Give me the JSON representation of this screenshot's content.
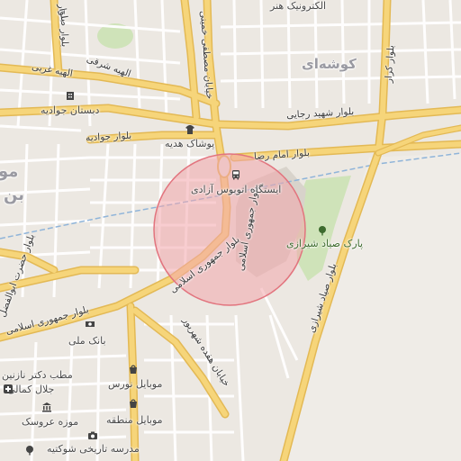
{
  "map": {
    "areas": {
      "goushei": "کوشه‌ای",
      "left_big_1": "مو",
      "left_big_2": "بن"
    },
    "roads": {
      "shahid_rajaee": "بلوار شهید رجایی",
      "emam_reza": "بلوار امام رضا",
      "javadieh": "بلوار جوادیه",
      "elahiye_sharghi": "الهیه شرقی",
      "elahiye_gharbi": "الهیه غربی",
      "solh": "بلوار صلح",
      "mostafa_khomeini": "خیابان مصطفی خمینی",
      "jomhouri_islami_1": "بلوار جمهوری اسلامی",
      "jomhouri_islami_2": "بلوار جمهوری اسلامی",
      "jomhouri_islami_3": "بلوار جمهوری اسلامی",
      "hazrat_abolfazl": "بلوار حضرت ابوالفضل",
      "hefdah_shahrivar": "خیابان هفده شهریور",
      "sayyad_shirazi": "بلوار صیاد شیرازی",
      "karar": "بلوار کرار",
      "bolvar_top_left": "بلوار"
    },
    "pois": {
      "electronic_honar": "الکترونیک هنر",
      "dabestan_javadieh": "دبستان جوادیه",
      "pooshak_hediyeh": "پوشاک هدیه",
      "bus_station": "ایستگاه اتوبوس آزادی",
      "park_sayyad": "پارک صیاد شیرازی",
      "bank_melli": "بانک ملی",
      "matab": "مطب دکتر نازنین",
      "jalal_kamali": "جلال کمالی",
      "mobile_nours": "موبایل نورس",
      "mobile_mantaghe": "موبایل منطقه",
      "mouze_arousak": "موزه عروسک",
      "madrese_shokatieh": "مدرسه تاریخی شوکتیه"
    },
    "colors": {
      "background": "#ece8e2",
      "major_road": "#f6d57a",
      "road_outline": "#e3b955",
      "minor_road": "#ffffff",
      "park": "#cfe3b9",
      "circle_fill": "#f3a5ac",
      "circle_stroke": "#e2747e",
      "rail": "#8fb4d9"
    }
  }
}
